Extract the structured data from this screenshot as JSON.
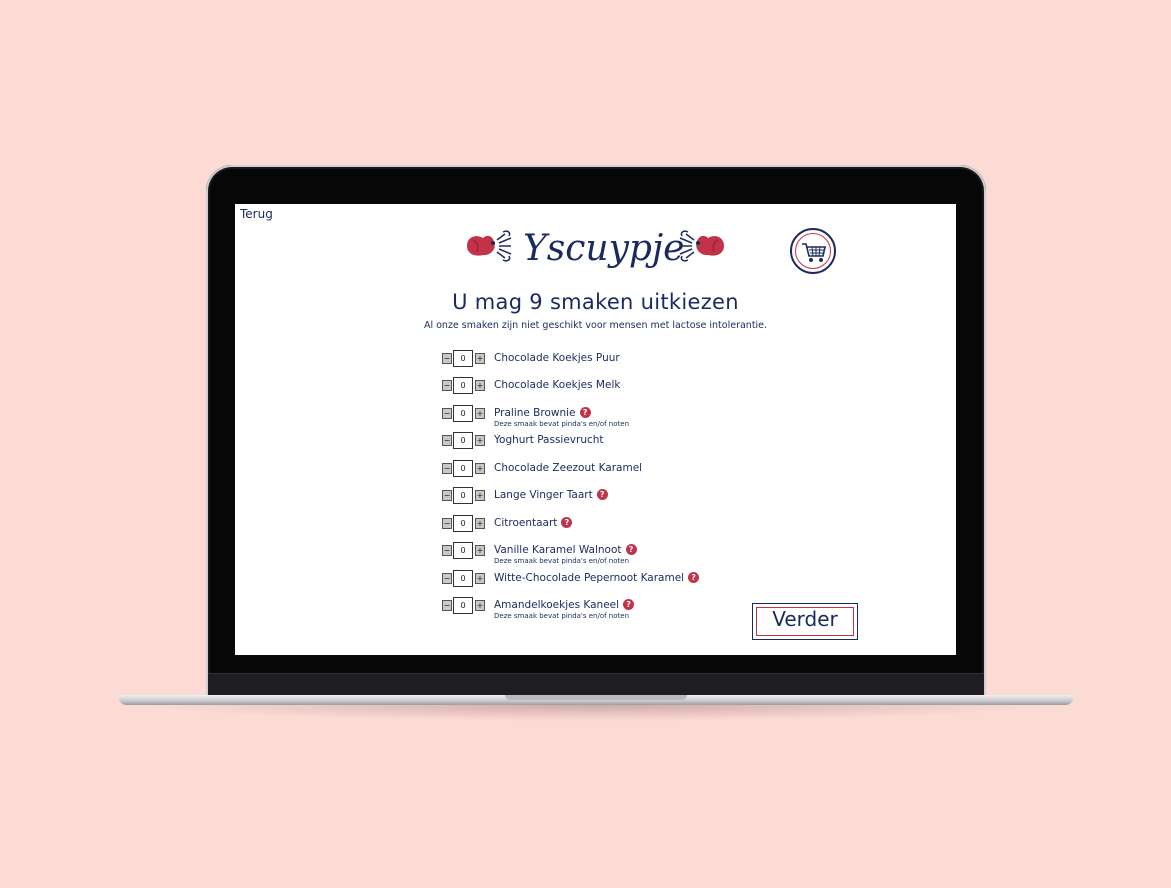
{
  "nav": {
    "back_label": "Terug"
  },
  "brand": {
    "name": "Yscuypje",
    "primary_color": "#1b2a5e",
    "accent_color": "#c2334a"
  },
  "header": {
    "cart_icon": "shopping-cart-icon"
  },
  "main": {
    "title": "U mag 9 smaken uitkiezen",
    "subtitle": "Al onze smaken zijn niet geschikt voor mensen met lactose intolerantie."
  },
  "stepper": {
    "minus_label": "−",
    "plus_label": "+"
  },
  "flavors": [
    {
      "name": "Chocolade Koekjes Puur",
      "quantity": "0",
      "help": false,
      "note": ""
    },
    {
      "name": "Chocolade Koekjes Melk",
      "quantity": "0",
      "help": false,
      "note": ""
    },
    {
      "name": "Praline Brownie",
      "quantity": "0",
      "help": true,
      "note": "Deze smaak bevat pinda's en/of noten"
    },
    {
      "name": "Yoghurt Passievrucht",
      "quantity": "0",
      "help": false,
      "note": ""
    },
    {
      "name": "Chocolade Zeezout Karamel",
      "quantity": "0",
      "help": false,
      "note": ""
    },
    {
      "name": "Lange Vinger Taart",
      "quantity": "0",
      "help": true,
      "note": ""
    },
    {
      "name": "Citroentaart",
      "quantity": "0",
      "help": true,
      "note": ""
    },
    {
      "name": "Vanille Karamel Walnoot",
      "quantity": "0",
      "help": true,
      "note": "Deze smaak bevat pinda's en/of noten"
    },
    {
      "name": "Witte-Chocolade Pepernoot Karamel",
      "quantity": "0",
      "help": true,
      "note": ""
    },
    {
      "name": "Amandelkoekjes Kaneel",
      "quantity": "0",
      "help": true,
      "note": "Deze smaak bevat pinda's en/of noten"
    }
  ],
  "help_glyph": "?",
  "actions": {
    "next_label": "Verder"
  }
}
